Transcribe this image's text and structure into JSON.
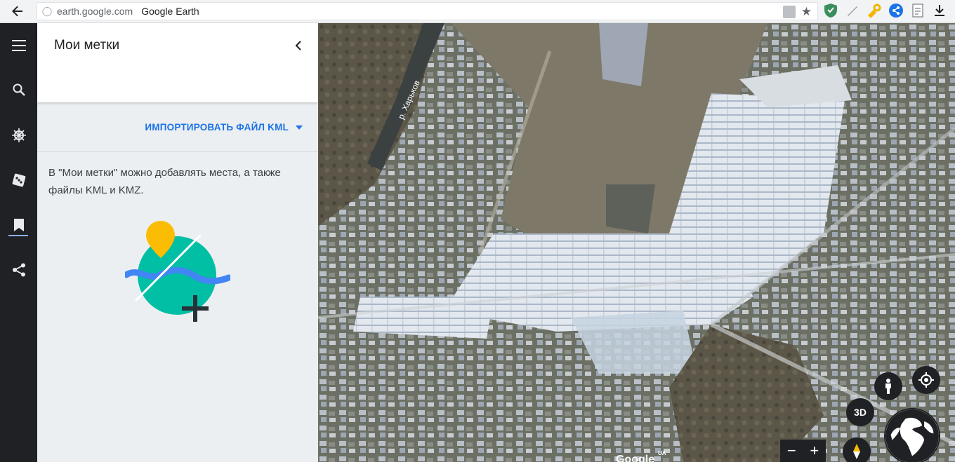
{
  "browser": {
    "url_host": "earth.google.com",
    "tab_title": "Google Earth"
  },
  "rail": {
    "items": [
      {
        "icon": "menu-icon"
      },
      {
        "icon": "search-icon"
      },
      {
        "icon": "voyager-icon"
      },
      {
        "icon": "feeling-lucky-icon"
      },
      {
        "icon": "projects-icon",
        "active": true
      },
      {
        "icon": "share-icon"
      }
    ]
  },
  "panel": {
    "title": "Мои метки",
    "import_label": "ИМПОРТИРОВАТЬ ФАЙЛ KML",
    "description": "В \"Мои метки\" можно добавлять места, а также файлы KML и KMZ."
  },
  "map": {
    "river_label": "р. Харьков",
    "btn_3d": "3D",
    "zoom_out": "−",
    "zoom_in": "+",
    "logo": "Google",
    "country_code": "UA"
  },
  "colors": {
    "accent": "#1a73e8",
    "rail_bg": "#202124",
    "panel_bg": "#eceff1",
    "pin_yellow": "#fbbc04",
    "teal": "#00bfa5",
    "wave_blue": "#4285f4"
  }
}
